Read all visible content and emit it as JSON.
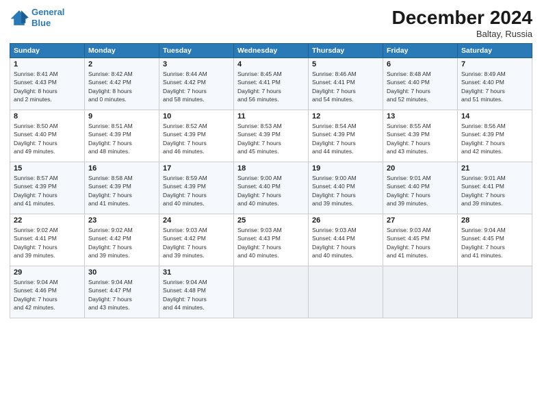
{
  "header": {
    "logo_line1": "General",
    "logo_line2": "Blue",
    "title": "December 2024",
    "subtitle": "Baltay, Russia"
  },
  "days_of_week": [
    "Sunday",
    "Monday",
    "Tuesday",
    "Wednesday",
    "Thursday",
    "Friday",
    "Saturday"
  ],
  "weeks": [
    [
      {
        "day": "1",
        "info": "Sunrise: 8:41 AM\nSunset: 4:43 PM\nDaylight: 8 hours\nand 2 minutes."
      },
      {
        "day": "2",
        "info": "Sunrise: 8:42 AM\nSunset: 4:42 PM\nDaylight: 8 hours\nand 0 minutes."
      },
      {
        "day": "3",
        "info": "Sunrise: 8:44 AM\nSunset: 4:42 PM\nDaylight: 7 hours\nand 58 minutes."
      },
      {
        "day": "4",
        "info": "Sunrise: 8:45 AM\nSunset: 4:41 PM\nDaylight: 7 hours\nand 56 minutes."
      },
      {
        "day": "5",
        "info": "Sunrise: 8:46 AM\nSunset: 4:41 PM\nDaylight: 7 hours\nand 54 minutes."
      },
      {
        "day": "6",
        "info": "Sunrise: 8:48 AM\nSunset: 4:40 PM\nDaylight: 7 hours\nand 52 minutes."
      },
      {
        "day": "7",
        "info": "Sunrise: 8:49 AM\nSunset: 4:40 PM\nDaylight: 7 hours\nand 51 minutes."
      }
    ],
    [
      {
        "day": "8",
        "info": "Sunrise: 8:50 AM\nSunset: 4:40 PM\nDaylight: 7 hours\nand 49 minutes."
      },
      {
        "day": "9",
        "info": "Sunrise: 8:51 AM\nSunset: 4:39 PM\nDaylight: 7 hours\nand 48 minutes."
      },
      {
        "day": "10",
        "info": "Sunrise: 8:52 AM\nSunset: 4:39 PM\nDaylight: 7 hours\nand 46 minutes."
      },
      {
        "day": "11",
        "info": "Sunrise: 8:53 AM\nSunset: 4:39 PM\nDaylight: 7 hours\nand 45 minutes."
      },
      {
        "day": "12",
        "info": "Sunrise: 8:54 AM\nSunset: 4:39 PM\nDaylight: 7 hours\nand 44 minutes."
      },
      {
        "day": "13",
        "info": "Sunrise: 8:55 AM\nSunset: 4:39 PM\nDaylight: 7 hours\nand 43 minutes."
      },
      {
        "day": "14",
        "info": "Sunrise: 8:56 AM\nSunset: 4:39 PM\nDaylight: 7 hours\nand 42 minutes."
      }
    ],
    [
      {
        "day": "15",
        "info": "Sunrise: 8:57 AM\nSunset: 4:39 PM\nDaylight: 7 hours\nand 41 minutes."
      },
      {
        "day": "16",
        "info": "Sunrise: 8:58 AM\nSunset: 4:39 PM\nDaylight: 7 hours\nand 41 minutes."
      },
      {
        "day": "17",
        "info": "Sunrise: 8:59 AM\nSunset: 4:39 PM\nDaylight: 7 hours\nand 40 minutes."
      },
      {
        "day": "18",
        "info": "Sunrise: 9:00 AM\nSunset: 4:40 PM\nDaylight: 7 hours\nand 40 minutes."
      },
      {
        "day": "19",
        "info": "Sunrise: 9:00 AM\nSunset: 4:40 PM\nDaylight: 7 hours\nand 39 minutes."
      },
      {
        "day": "20",
        "info": "Sunrise: 9:01 AM\nSunset: 4:40 PM\nDaylight: 7 hours\nand 39 minutes."
      },
      {
        "day": "21",
        "info": "Sunrise: 9:01 AM\nSunset: 4:41 PM\nDaylight: 7 hours\nand 39 minutes."
      }
    ],
    [
      {
        "day": "22",
        "info": "Sunrise: 9:02 AM\nSunset: 4:41 PM\nDaylight: 7 hours\nand 39 minutes."
      },
      {
        "day": "23",
        "info": "Sunrise: 9:02 AM\nSunset: 4:42 PM\nDaylight: 7 hours\nand 39 minutes."
      },
      {
        "day": "24",
        "info": "Sunrise: 9:03 AM\nSunset: 4:42 PM\nDaylight: 7 hours\nand 39 minutes."
      },
      {
        "day": "25",
        "info": "Sunrise: 9:03 AM\nSunset: 4:43 PM\nDaylight: 7 hours\nand 40 minutes."
      },
      {
        "day": "26",
        "info": "Sunrise: 9:03 AM\nSunset: 4:44 PM\nDaylight: 7 hours\nand 40 minutes."
      },
      {
        "day": "27",
        "info": "Sunrise: 9:03 AM\nSunset: 4:45 PM\nDaylight: 7 hours\nand 41 minutes."
      },
      {
        "day": "28",
        "info": "Sunrise: 9:04 AM\nSunset: 4:45 PM\nDaylight: 7 hours\nand 41 minutes."
      }
    ],
    [
      {
        "day": "29",
        "info": "Sunrise: 9:04 AM\nSunset: 4:46 PM\nDaylight: 7 hours\nand 42 minutes."
      },
      {
        "day": "30",
        "info": "Sunrise: 9:04 AM\nSunset: 4:47 PM\nDaylight: 7 hours\nand 43 minutes."
      },
      {
        "day": "31",
        "info": "Sunrise: 9:04 AM\nSunset: 4:48 PM\nDaylight: 7 hours\nand 44 minutes."
      },
      {
        "day": "",
        "info": ""
      },
      {
        "day": "",
        "info": ""
      },
      {
        "day": "",
        "info": ""
      },
      {
        "day": "",
        "info": ""
      }
    ]
  ]
}
